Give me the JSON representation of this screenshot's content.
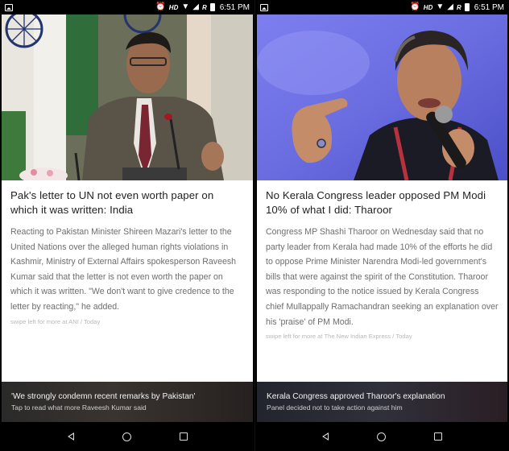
{
  "status_bar": {
    "hd_label": "HD",
    "r_label": "R",
    "time": "6:51 PM"
  },
  "left_screen": {
    "headline": "Pak's letter to UN not even worth paper on which it was written: India",
    "body": "Reacting to Pakistan Minister Shireen Mazari's letter to the United Nations over the alleged human rights violations in Kashmir, Ministry of External Affairs spokesperson Raveesh Kumar said that the letter is not even worth the paper on which it was written. \"We don't want to give credence to the letter by reacting,\" he added.",
    "source_line": "swipe left for more at ANI / Today",
    "banner_title": "'We strongly condemn recent remarks by Pakistan'",
    "banner_subtitle": "Tap to read what more Raveesh Kumar said"
  },
  "right_screen": {
    "headline": "No Kerala Congress leader opposed PM Modi 10% of what I did: Tharoor",
    "body": "Congress MP Shashi Tharoor on Wednesday said that no party leader from Kerala had made 10% of the efforts he did to oppose Prime Minister Narendra Modi-led government's bills that were against the spirit of the Constitution. Tharoor was responding to the notice issued by Kerala Congress chief Mullappally Ramachandran seeking an explanation over his 'praise' of PM Modi.",
    "source_line": "swipe left for more at The New Indian Express / Today",
    "banner_title": "Kerala Congress approved Tharoor's explanation",
    "banner_subtitle": "Panel decided not to take action against him"
  },
  "icons": {
    "status": [
      "image-icon",
      "alarm-icon",
      "wifi-icon",
      "signal-icon",
      "battery-icon"
    ],
    "nav": [
      "back-icon",
      "home-icon",
      "recents-icon"
    ]
  }
}
